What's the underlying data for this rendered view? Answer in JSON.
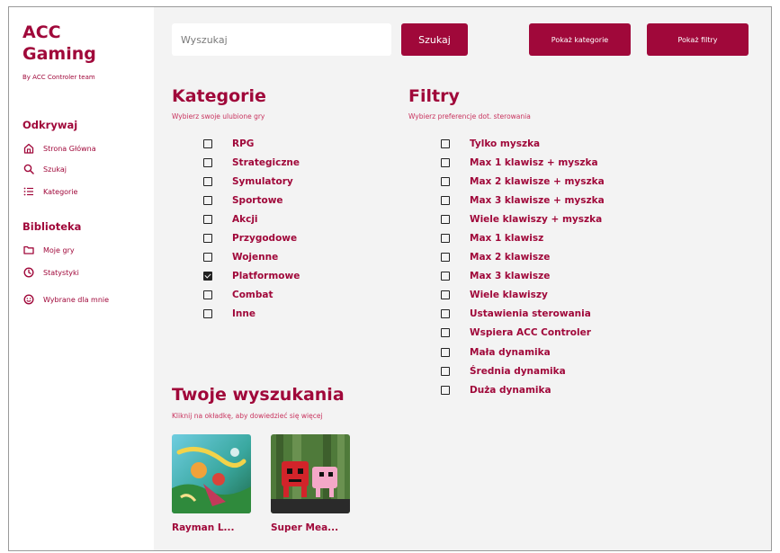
{
  "brand": {
    "line1": "ACC",
    "line2": "Gaming",
    "subtitle": "By ACC Controler team"
  },
  "sidebar": {
    "discover_title": "Odkrywaj",
    "discover_items": [
      {
        "label": "Strona Główna",
        "icon": "home-icon"
      },
      {
        "label": "Szukaj",
        "icon": "search-icon"
      },
      {
        "label": "Kategorie",
        "icon": "list-icon"
      }
    ],
    "library_title": "Biblioteka",
    "library_items": [
      {
        "label": "Moje gry",
        "icon": "folder-icon"
      },
      {
        "label": "Statystyki",
        "icon": "clock-icon"
      },
      {
        "label": "Wybrane dla mnie",
        "icon": "smiley-icon"
      }
    ]
  },
  "search": {
    "placeholder": "Wyszukaj",
    "button_label": "Szukaj",
    "show_categories_label": "Pokaż kategorie",
    "show_filters_label": "Pokaż filtry"
  },
  "categories": {
    "title": "Kategorie",
    "subtitle": "Wybierz swoje ulubione gry",
    "items": [
      {
        "label": "RPG",
        "checked": false
      },
      {
        "label": "Strategiczne",
        "checked": false
      },
      {
        "label": "Symulatory",
        "checked": false
      },
      {
        "label": "Sportowe",
        "checked": false
      },
      {
        "label": "Akcji",
        "checked": false
      },
      {
        "label": "Przygodowe",
        "checked": false
      },
      {
        "label": "Wojenne",
        "checked": false
      },
      {
        "label": "Platformowe",
        "checked": true
      },
      {
        "label": "Combat",
        "checked": false
      },
      {
        "label": "Inne",
        "checked": false
      }
    ]
  },
  "filters": {
    "title": "Filtry",
    "subtitle": "Wybierz preferencje dot. sterowania",
    "items": [
      {
        "label": "Tylko myszka",
        "checked": false
      },
      {
        "label": "Max 1 klawisz + myszka",
        "checked": false
      },
      {
        "label": "Max 2 klawisze + myszka",
        "checked": false
      },
      {
        "label": "Max 3 klawisze + myszka",
        "checked": false
      },
      {
        "label": "Wiele klawiszy + myszka",
        "checked": false
      },
      {
        "label": "Max 1 klawisz",
        "checked": false
      },
      {
        "label": "Max 2 klawisze",
        "checked": false
      },
      {
        "label": "Max 3 klawisze",
        "checked": false
      },
      {
        "label": "Wiele klawiszy",
        "checked": false
      },
      {
        "label": "Ustawienia sterowania",
        "checked": false
      },
      {
        "label": "Wspiera ACC Controler",
        "checked": false
      },
      {
        "label": "Mała dynamika",
        "checked": false
      },
      {
        "label": "Średnia dynamika",
        "checked": false
      },
      {
        "label": "Duża dynamika",
        "checked": false
      }
    ]
  },
  "results": {
    "title": "Twoje wyszukania",
    "subtitle": "Kliknij na okładkę, aby dowiedzieć się więcej",
    "games": [
      {
        "title": "Rayman L..."
      },
      {
        "title": "Super Mea..."
      }
    ]
  },
  "colors": {
    "accent": "#a0083a",
    "main_bg": "#f3f3f3"
  }
}
